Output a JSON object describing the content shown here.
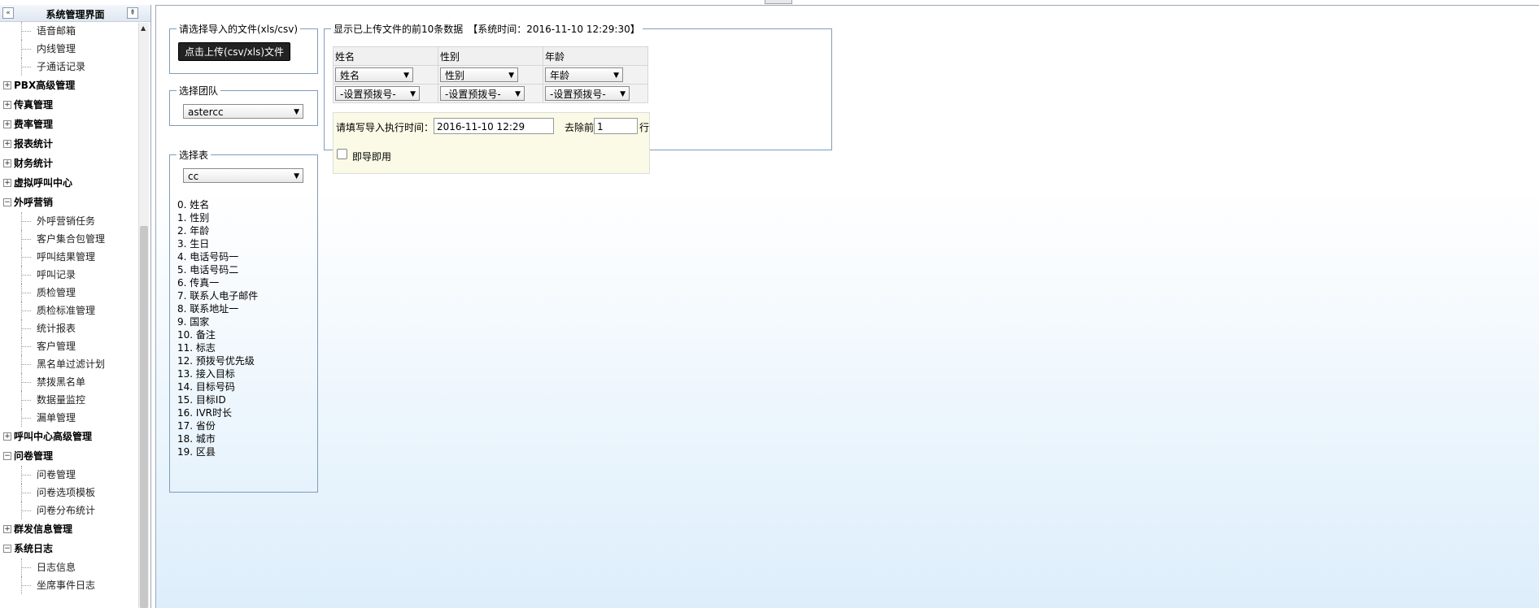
{
  "sidebar": {
    "title": "系统管理界面",
    "collapse_glyph": "«",
    "pin_glyph": "⇞",
    "tree": [
      {
        "type": "leaf",
        "label": "语音邮箱"
      },
      {
        "type": "leaf",
        "label": "内线管理"
      },
      {
        "type": "leaf",
        "label": "子通话记录"
      },
      {
        "type": "node",
        "label": "PBX高级管理",
        "expanded": false
      },
      {
        "type": "node",
        "label": "传真管理",
        "expanded": false
      },
      {
        "type": "node",
        "label": "费率管理",
        "expanded": false
      },
      {
        "type": "node",
        "label": "报表统计",
        "expanded": false
      },
      {
        "type": "node",
        "label": "财务统计",
        "expanded": false
      },
      {
        "type": "node",
        "label": "虚拟呼叫中心",
        "expanded": false
      },
      {
        "type": "node",
        "label": "外呼营销",
        "expanded": true
      },
      {
        "type": "leaf",
        "label": "外呼营销任务"
      },
      {
        "type": "leaf",
        "label": "客户集合包管理"
      },
      {
        "type": "leaf",
        "label": "呼叫结果管理"
      },
      {
        "type": "leaf",
        "label": "呼叫记录"
      },
      {
        "type": "leaf",
        "label": "质检管理"
      },
      {
        "type": "leaf",
        "label": "质检标准管理"
      },
      {
        "type": "leaf",
        "label": "统计报表"
      },
      {
        "type": "leaf",
        "label": "客户管理"
      },
      {
        "type": "leaf",
        "label": "黑名单过滤计划"
      },
      {
        "type": "leaf",
        "label": "禁拨黑名单"
      },
      {
        "type": "leaf",
        "label": "数据量监控"
      },
      {
        "type": "leaf",
        "label": "漏单管理"
      },
      {
        "type": "node",
        "label": "呼叫中心高级管理",
        "expanded": false
      },
      {
        "type": "node",
        "label": "问卷管理",
        "expanded": true
      },
      {
        "type": "leaf",
        "label": "问卷管理"
      },
      {
        "type": "leaf",
        "label": "问卷选项模板"
      },
      {
        "type": "leaf",
        "label": "问卷分布统计"
      },
      {
        "type": "node",
        "label": "群发信息管理",
        "expanded": false
      },
      {
        "type": "node",
        "label": "系统日志",
        "expanded": true
      },
      {
        "type": "leaf",
        "label": "日志信息"
      },
      {
        "type": "leaf",
        "label": "坐席事件日志"
      }
    ]
  },
  "upload": {
    "legend": "请选择导入的文件(xls/csv)",
    "button_label": "点击上传(csv/xls)文件"
  },
  "team": {
    "legend": "选择团队",
    "selected": "astercc"
  },
  "table_select": {
    "legend": "选择表",
    "selected": "cc",
    "fields": [
      "0. 姓名",
      "1. 性别",
      "2. 年龄",
      "3. 生日",
      "4. 电话号码一",
      "5. 电话号码二",
      "6. 传真一",
      "7. 联系人电子邮件",
      "8. 联系地址一",
      "9. 国家",
      "10. 备注",
      "11. 标志",
      "12. 预拨号优先级",
      "13. 接入目标",
      "14. 目标号码",
      "15. 目标ID",
      "16. IVR时长",
      "17. 省份",
      "18. 城市",
      "19. 区县"
    ]
  },
  "preview": {
    "legend": "显示已上传文件的前10条数据　【系统时间：2016-11-10 12:29:30】",
    "columns": [
      "姓名",
      "性别",
      "年龄"
    ],
    "mapping": [
      "姓名",
      "性别",
      "年龄"
    ],
    "prefix": [
      "-设置预拨号-",
      "-设置预拨号-",
      "-设置预拨号-"
    ],
    "exec_time_label": "请填写导入执行时间：",
    "exec_time_value": "2016-11-10 12:29",
    "skip_label": "去除前",
    "skip_value": "1",
    "skip_unit": "行",
    "immediate_label": "即导即用"
  },
  "colors": {
    "border": "#7f9db9",
    "button_bg": "#222222",
    "exec_bg": "#fafae6",
    "gradient_end": "#ddeefb"
  }
}
